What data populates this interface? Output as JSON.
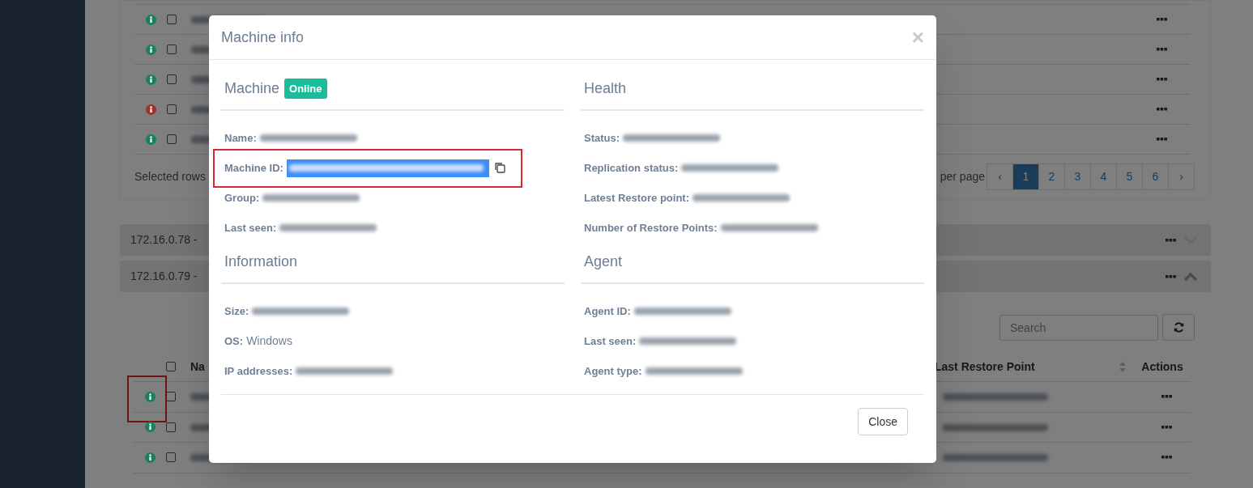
{
  "background": {
    "top_rows": [
      {
        "color": "#1a7f5f",
        "checked": false
      },
      {
        "color": "#1a7f5f",
        "checked": false
      },
      {
        "color": "#1a7f5f",
        "checked": false
      },
      {
        "color": "#a3302a",
        "checked": false
      },
      {
        "color": "#1a7f5f",
        "checked": false
      }
    ],
    "selected_rows_label": "Selected rows",
    "per_page_label": "per page",
    "pagination": [
      {
        "label": "‹",
        "selected": false
      },
      {
        "label": "1",
        "selected": true
      },
      {
        "label": "2",
        "selected": false
      },
      {
        "label": "3",
        "selected": false
      },
      {
        "label": "4",
        "selected": false
      },
      {
        "label": "5",
        "selected": false
      },
      {
        "label": "6",
        "selected": false
      },
      {
        "label": "›",
        "selected": false
      }
    ],
    "groups": [
      {
        "title": "172.16.0.78 -",
        "expanded": false
      },
      {
        "title": "172.16.0.79 -",
        "expanded": true
      }
    ],
    "search": {
      "placeholder": "Search"
    },
    "table": {
      "select_all_checked": false,
      "columns": [
        "Na",
        "Last Restore Point",
        "Actions"
      ],
      "rows": [
        {
          "color": "#1a7f5f",
          "checked": false,
          "highlighted": true
        },
        {
          "color": "#1a7f5f",
          "checked": false,
          "highlighted": false
        },
        {
          "color": "#1a7f5f",
          "checked": false,
          "highlighted": false
        }
      ]
    }
  },
  "modal": {
    "title": "Machine info",
    "close_glyph": "×",
    "sections": [
      {
        "title": "Machine",
        "badge": "Online",
        "fields": [
          {
            "label": "Name:",
            "redacted": true
          },
          {
            "label": "Machine ID:",
            "redacted": true,
            "selected": true,
            "highlighted": true,
            "copyable": true
          },
          {
            "label": "Group:",
            "redacted": true
          },
          {
            "label": "Last seen:",
            "redacted": true
          }
        ]
      },
      {
        "title": "Health",
        "fields": [
          {
            "label": "Status:",
            "redacted": true
          },
          {
            "label": "Replication status:",
            "redacted": true
          },
          {
            "label": "Latest Restore point:",
            "redacted": true
          },
          {
            "label": "Number of Restore Points:",
            "redacted": true
          }
        ]
      },
      {
        "title": "Information",
        "fields": [
          {
            "label": "Size:",
            "redacted": true
          },
          {
            "label": "OS:",
            "value": "Windows"
          },
          {
            "label": "IP addresses:",
            "redacted": true
          }
        ]
      },
      {
        "title": "Agent",
        "fields": [
          {
            "label": "Agent ID:",
            "redacted": true
          },
          {
            "label": "Last seen:",
            "redacted": true
          },
          {
            "label": "Agent type:",
            "redacted": true
          }
        ]
      }
    ],
    "close_button": "Close"
  }
}
